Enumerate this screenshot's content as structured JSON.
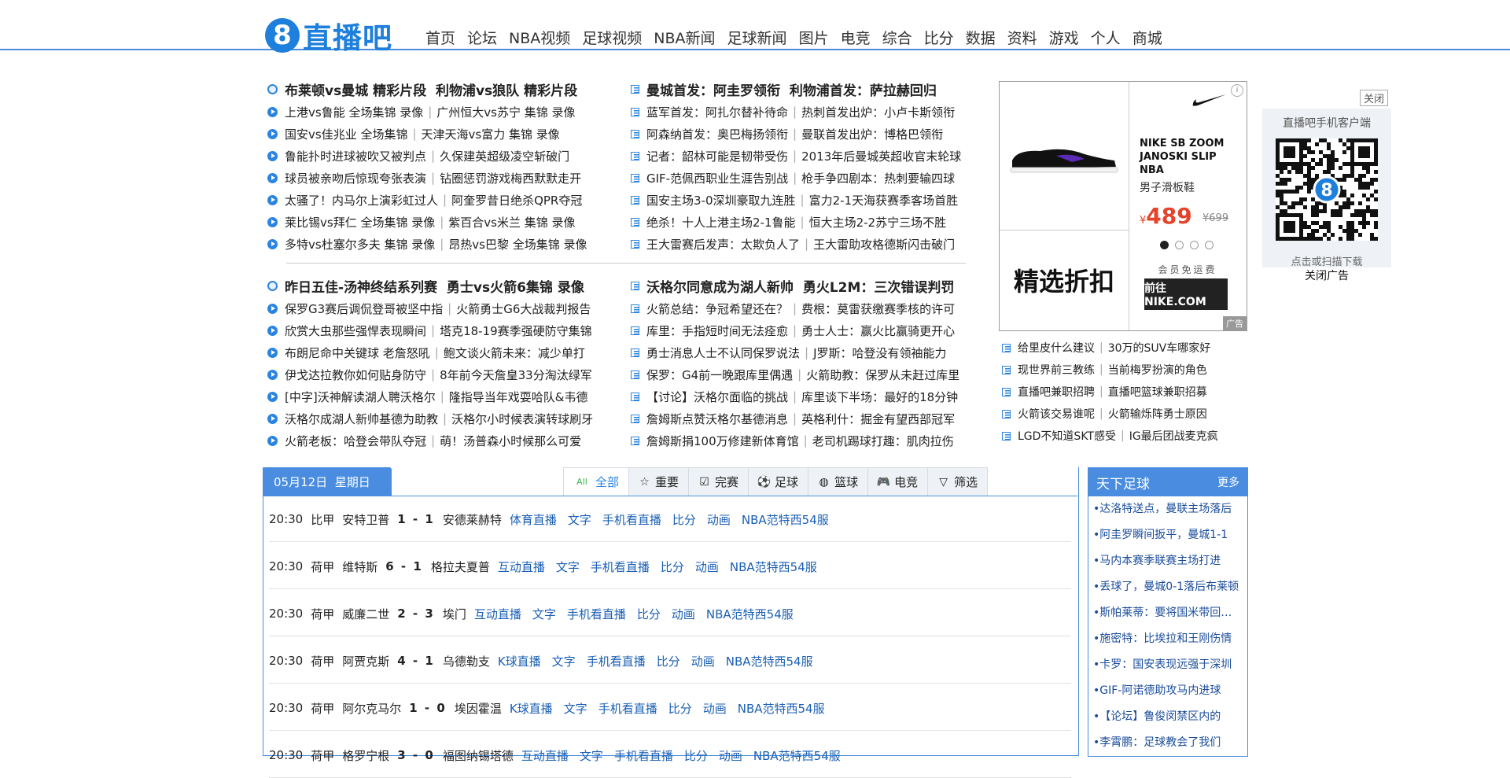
{
  "header": {
    "logo_digit": "8",
    "logo_text": "直播吧",
    "nav": [
      "首页",
      "论坛",
      "NBA视频",
      "足球视频",
      "NBA新闻",
      "足球新闻",
      "图片",
      "电竞",
      "综合",
      "比分",
      "数据",
      "资料",
      "游戏",
      "个人",
      "商城"
    ]
  },
  "news_left_top": {
    "head": [
      "布莱顿vs曼城 精彩片段",
      "利物浦vs狼队 精彩片段"
    ],
    "rows": [
      [
        "上港vs鲁能 全场集锦 录像",
        "广州恒大vs苏宁 集锦 录像"
      ],
      [
        "国安vs佳兆业 全场集锦",
        "天津天海vs富力 集锦 录像"
      ],
      [
        "鲁能扑时进球被吹又被判点",
        "久保建英超级凌空斩破门"
      ],
      [
        "球员被亲吻后惊现夸张表演",
        "钻圈惩罚游戏梅西默默走开"
      ],
      [
        "太骚了！内马尔上演彩虹过人",
        "阿奎罗昔日绝杀QPR夺冠"
      ],
      [
        "莱比锡vs拜仁 全场集锦 录像",
        "紫百合vs米兰 集锦 录像"
      ],
      [
        "多特vs杜塞尔多夫 集锦 录像",
        "昂热vs巴黎 全场集锦 录像"
      ]
    ]
  },
  "news_right_top": {
    "head": [
      "曼城首发：阿圭罗领衔",
      "利物浦首发：萨拉赫回归"
    ],
    "rows": [
      [
        "蓝军首发：阿扎尔替补待命",
        "热刺首发出炉：小卢卡斯领衔"
      ],
      [
        "阿森纳首发：奥巴梅扬领衔",
        "曼联首发出炉：博格巴领衔"
      ],
      [
        "记者：韶林可能是韧带受伤",
        "2013年后曼城英超收官末轮球"
      ],
      [
        "GIF-范佩西职业生涯告别战",
        "枪手争四剧本：热刺要输四球"
      ],
      [
        "国安主场3-0深圳豪取九连胜",
        "富力2-1天海获赛季客场首胜"
      ],
      [
        "绝杀！十人上港主场2-1鲁能",
        "恒大主场2-2苏宁三场不胜"
      ],
      [
        "王大雷赛后发声：太欺负人了",
        "王大雷助攻格德斯闪击破门"
      ]
    ]
  },
  "news_left_bottom": {
    "head": [
      "昨日五佳-汤神终结系列赛",
      "勇士vs火箭6集锦 录像"
    ],
    "rows": [
      [
        "保罗G3赛后调侃登哥被坚中指",
        "火箭勇士G6大战裁判报告"
      ],
      [
        "欣赏大虫那些强悍表现瞬间",
        "塔克18-19赛季强硬防守集锦"
      ],
      [
        "布朗尼命中关键球 老詹怒吼",
        "鲍文谈火箭未来：减少单打"
      ],
      [
        "伊戈达拉教你如何贴身防守",
        "8年前今天詹皇33分淘汰绿军"
      ],
      [
        "[中字]沃神解读湖人聘沃格尔",
        "隆指导当年戏耍哈队&韦德"
      ],
      [
        "沃格尔成湖人新帅基德为助教",
        "沃格尔小时候表演转球刷牙"
      ],
      [
        "火箭老板：哈登会带队夺冠",
        "萌！汤普森小时候那么可爱"
      ]
    ]
  },
  "news_right_bottom": {
    "head": [
      "沃格尔同意成为湖人新帅",
      "勇火L2M：三次错误判罚"
    ],
    "rows": [
      [
        "火箭总结：争冠希望还在？",
        "费根：莫雷获缴赛季核的许可"
      ],
      [
        "库里：手指短时间无法痊愈",
        "勇士人士：赢火比赢骑更开心"
      ],
      [
        "勇士消息人士不认同保罗说法",
        "J罗斯：哈登没有领袖能力"
      ],
      [
        "保罗：G4前一晚跟库里偶遇",
        "火箭助教：保罗从未赶过库里"
      ],
      [
        "【讨论】沃格尔面临的挑战",
        "库里谈下半场：最好的18分钟"
      ],
      [
        "詹姆斯点赞沃格尔基德消息",
        "英格利什：掘金有望西部冠军"
      ],
      [
        "詹姆斯捐100万修建新体育馆",
        "老司机踢球打趣：肌肉拉伤"
      ]
    ]
  },
  "ad": {
    "product_name": "NIKE SB ZOOM JANOSKI SLIP NBA",
    "product_sub": "男子滑板鞋",
    "currency": "¥",
    "price": "489",
    "old_price": "¥699",
    "promo": "精选折扣",
    "member": "会员免运费",
    "button": "前往 NIKE.COM",
    "tag": "广告",
    "info": "i",
    "carousel_total": 4,
    "carousel_active": 1
  },
  "ad_links": [
    [
      "给里皮什么建议",
      "30万的SUV车哪家好"
    ],
    [
      "现世界前三教练",
      "当前梅罗扮演的角色"
    ],
    [
      "直播吧兼职招聘",
      "直播吧篮球兼职招募"
    ],
    [
      "火箭该交易谁呢",
      "火箭输烁阵勇士原因"
    ],
    [
      "LGD不知道SKT感受",
      "IG最后团战麦克疯"
    ]
  ],
  "qr": {
    "close": "关闭",
    "title": "直播吧手机客户端",
    "sub": "点击或扫描下载",
    "close_ad": "关闭广告"
  },
  "schedule": {
    "date": "05月12日",
    "weekday": "星期日",
    "tabs": [
      {
        "label": "全部",
        "icon": "all-icon",
        "glyph": "All"
      },
      {
        "label": "重要",
        "icon": "star-icon",
        "glyph": "☆"
      },
      {
        "label": "完赛",
        "icon": "check-icon",
        "glyph": "☑"
      },
      {
        "label": "足球",
        "icon": "football-icon",
        "glyph": "⚽"
      },
      {
        "label": "篮球",
        "icon": "basketball-icon",
        "glyph": "◍"
      },
      {
        "label": "电竞",
        "icon": "gamepad-icon",
        "glyph": "🎮"
      },
      {
        "label": "筛选",
        "icon": "filter-icon",
        "glyph": "▽"
      }
    ],
    "matches": [
      {
        "time": "20:30",
        "league": "比甲",
        "home": "安特卫普",
        "score": "1 - 1",
        "away": "安德莱赫特",
        "links": [
          "体育直播",
          "文字",
          "手机看直播",
          "比分",
          "动画",
          "NBA范特西54服"
        ]
      },
      {
        "time": "20:30",
        "league": "荷甲",
        "home": "维特斯",
        "score": "6 - 1",
        "away": "格拉夫夏普",
        "links": [
          "互动直播",
          "文字",
          "手机看直播",
          "比分",
          "动画",
          "NBA范特西54服"
        ]
      },
      {
        "time": "20:30",
        "league": "荷甲",
        "home": "威廉二世",
        "score": "2 - 3",
        "away": "埃门",
        "links": [
          "互动直播",
          "文字",
          "手机看直播",
          "比分",
          "动画",
          "NBA范特西54服"
        ]
      },
      {
        "time": "20:30",
        "league": "荷甲",
        "home": "阿贾克斯",
        "score": "4 - 1",
        "away": "乌德勒支",
        "links": [
          "K球直播",
          "文字",
          "手机看直播",
          "比分",
          "动画",
          "NBA范特西54服"
        ]
      },
      {
        "time": "20:30",
        "league": "荷甲",
        "home": "阿尔克马尔",
        "score": "1 - 0",
        "away": "埃因霍温",
        "links": [
          "K球直播",
          "文字",
          "手机看直播",
          "比分",
          "动画",
          "NBA范特西54服"
        ]
      },
      {
        "time": "20:30",
        "league": "荷甲",
        "home": "格罗宁根",
        "score": "3 - 0",
        "away": "福图纳锡塔德",
        "links": [
          "互动直播",
          "文字",
          "手机看直播",
          "比分",
          "动画",
          "NBA范特西54服"
        ]
      }
    ]
  },
  "side_news": {
    "title": "天下足球",
    "more": "更多",
    "items": [
      "达洛特送点，曼联主场落后",
      "阿圭罗瞬间扳平，曼城1-1",
      "马内本赛季联赛主场打进",
      "丢球了，曼城0-1落后布莱顿",
      "斯帕莱蒂：要将国米带回欧冠",
      "施密特：比埃拉和王刚伤情",
      "卡罗：国安表现远强于深圳",
      "GIF-阿诺德助攻马内进球",
      "【论坛】鲁俊闵禁区内的",
      "李霄鹏：足球教会了我们"
    ]
  }
}
